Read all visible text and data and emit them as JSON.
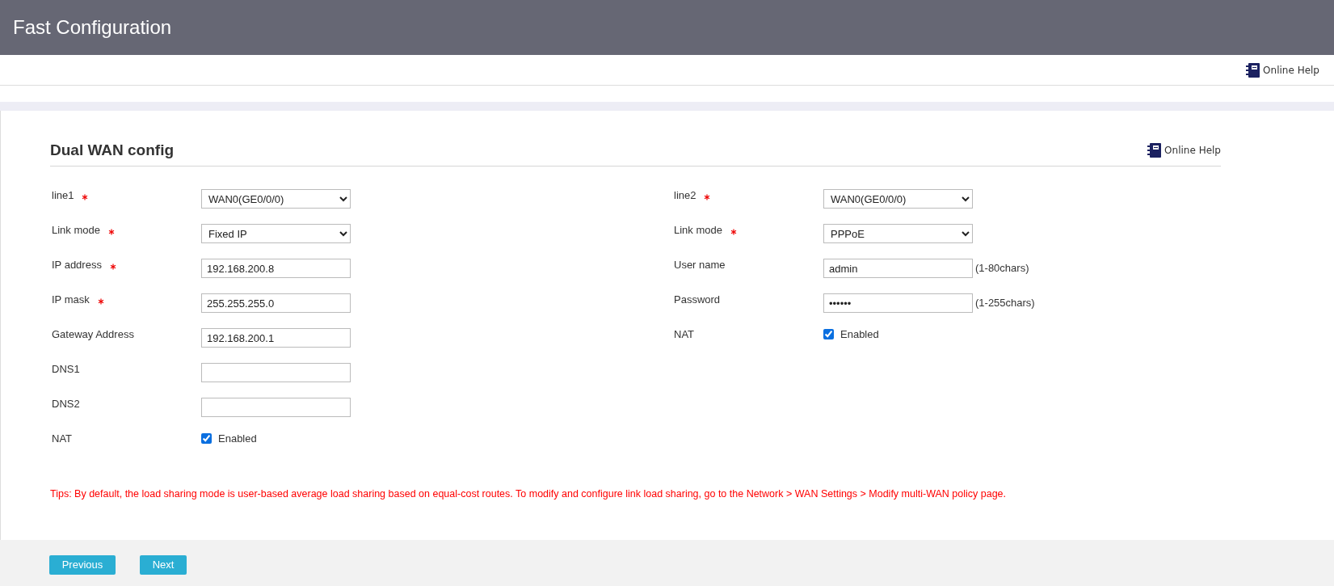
{
  "header": {
    "title": "Fast Configuration"
  },
  "top_help": {
    "label": "Online Help"
  },
  "section": {
    "title": "Dual WAN config",
    "help": "Online Help"
  },
  "columns": [
    {
      "fields": [
        {
          "kind": "select",
          "label": "line1",
          "required": true,
          "value": "WAN0(GE0/0/0)"
        },
        {
          "kind": "select",
          "label": "Link mode",
          "required": true,
          "value": "Fixed IP"
        },
        {
          "kind": "text",
          "label": "IP address",
          "required": true,
          "value": "192.168.200.8"
        },
        {
          "kind": "text",
          "label": "IP mask",
          "required": true,
          "value": "255.255.255.0"
        },
        {
          "kind": "text",
          "label": "Gateway Address",
          "required": false,
          "value": "192.168.200.1"
        },
        {
          "kind": "text",
          "label": "DNS1",
          "required": false
        },
        {
          "kind": "text",
          "label": "DNS2",
          "required": false
        },
        {
          "kind": "checkbox",
          "label": "NAT",
          "required": false,
          "checked": true,
          "option": "Enabled"
        }
      ]
    },
    {
      "fields": [
        {
          "kind": "select",
          "label": "line2",
          "required": true,
          "value": "WAN0(GE0/0/0)"
        },
        {
          "kind": "select",
          "label": "Link mode",
          "required": true,
          "value": "PPPoE"
        },
        {
          "kind": "text",
          "label": "User name",
          "required": false,
          "value": "admin",
          "hint": "(1-80chars)"
        },
        {
          "kind": "password",
          "label": "Password",
          "required": false,
          "value": "••••••",
          "hint": "(1-255chars)"
        },
        {
          "kind": "checkbox",
          "label": "NAT",
          "required": false,
          "checked": true,
          "option": "Enabled"
        }
      ]
    }
  ],
  "tips": "Tips: By default, the load sharing mode is user-based average load sharing based on equal-cost routes. To modify and configure link load sharing, go to the Network > WAN Settings > Modify multi-WAN policy page.",
  "buttons": [
    {
      "label": "Previous"
    },
    {
      "label": "Next"
    }
  ]
}
